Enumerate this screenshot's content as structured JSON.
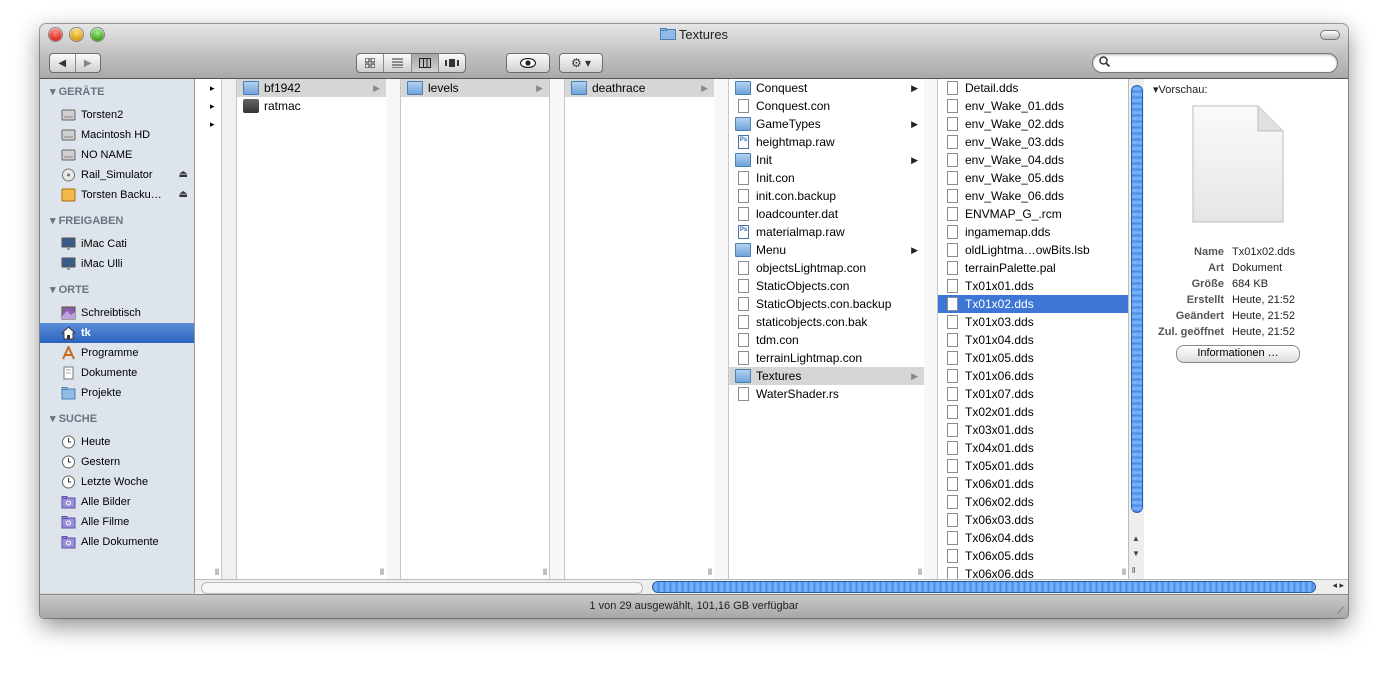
{
  "window": {
    "title": "Textures"
  },
  "toolbar": {
    "nav": [
      "◀",
      "▶"
    ],
    "views": [
      "icon-view",
      "list-view",
      "column-view",
      "coverflow-view"
    ],
    "quicklook": "👁",
    "action": "⚙ ▾",
    "search": {
      "value": "",
      "placeholder": ""
    }
  },
  "sidebar": {
    "sections": [
      {
        "title": "GERÄTE",
        "items": [
          {
            "label": "Torsten2",
            "icon": "hd-icon"
          },
          {
            "label": "Macintosh HD",
            "icon": "hd-icon"
          },
          {
            "label": "NO NAME",
            "icon": "hd-icon"
          },
          {
            "label": "Rail_Simulator",
            "icon": "cd-icon",
            "eject": true
          },
          {
            "label": "Torsten Backu…",
            "icon": "backup-icon",
            "eject": true
          }
        ]
      },
      {
        "title": "FREIGABEN",
        "items": [
          {
            "label": "iMac Cati",
            "icon": "imac-icon"
          },
          {
            "label": "iMac Ulli",
            "icon": "imac-icon"
          }
        ]
      },
      {
        "title": "ORTE",
        "items": [
          {
            "label": "Schreibtisch",
            "icon": "desktop-icon"
          },
          {
            "label": "tk",
            "icon": "home-icon",
            "selected": true
          },
          {
            "label": "Programme",
            "icon": "apps-icon"
          },
          {
            "label": "Dokumente",
            "icon": "documents-icon"
          },
          {
            "label": "Projekte",
            "icon": "folder-icon"
          }
        ]
      },
      {
        "title": "SUCHE",
        "items": [
          {
            "label": "Heute",
            "icon": "clock-icon"
          },
          {
            "label": "Gestern",
            "icon": "clock-icon"
          },
          {
            "label": "Letzte Woche",
            "icon": "clock-icon"
          },
          {
            "label": "Alle Bilder",
            "icon": "smart-folder-icon"
          },
          {
            "label": "Alle Filme",
            "icon": "smart-folder-icon"
          },
          {
            "label": "Alle Dokumente",
            "icon": "smart-folder-icon"
          }
        ]
      }
    ]
  },
  "columns": [
    {
      "items": [
        {
          "label": "bf1942",
          "type": "folder",
          "path": true,
          "arrow": true
        },
        {
          "label": "ratmac",
          "type": "disk"
        }
      ]
    },
    {
      "items": [
        {
          "label": "levels",
          "type": "folder",
          "path": true,
          "arrow": true
        }
      ]
    },
    {
      "items": [
        {
          "label": "deathrace",
          "type": "folder",
          "path": true,
          "arrow": true
        }
      ]
    },
    {
      "items": [
        {
          "label": "Conquest",
          "type": "folder",
          "arrow": true
        },
        {
          "label": "Conquest.con",
          "type": "doc"
        },
        {
          "label": "GameTypes",
          "type": "folder",
          "arrow": true
        },
        {
          "label": "heightmap.raw",
          "type": "ps"
        },
        {
          "label": "Init",
          "type": "folder",
          "arrow": true
        },
        {
          "label": "Init.con",
          "type": "doc"
        },
        {
          "label": "init.con.backup",
          "type": "doc"
        },
        {
          "label": "loadcounter.dat",
          "type": "doc"
        },
        {
          "label": "materialmap.raw",
          "type": "ps"
        },
        {
          "label": "Menu",
          "type": "folder",
          "arrow": true
        },
        {
          "label": "objectsLightmap.con",
          "type": "doc"
        },
        {
          "label": "StaticObjects.con",
          "type": "doc"
        },
        {
          "label": "StaticObjects.con.backup",
          "type": "doc"
        },
        {
          "label": "staticobjects.con.bak",
          "type": "doc"
        },
        {
          "label": "tdm.con",
          "type": "doc"
        },
        {
          "label": "terrainLightmap.con",
          "type": "doc"
        },
        {
          "label": "Textures",
          "type": "folder",
          "path": true,
          "arrow": true
        },
        {
          "label": "WaterShader.rs",
          "type": "doc"
        }
      ]
    },
    {
      "items": [
        {
          "label": "Detail.dds",
          "type": "doc"
        },
        {
          "label": "env_Wake_01.dds",
          "type": "doc"
        },
        {
          "label": "env_Wake_02.dds",
          "type": "doc"
        },
        {
          "label": "env_Wake_03.dds",
          "type": "doc"
        },
        {
          "label": "env_Wake_04.dds",
          "type": "doc"
        },
        {
          "label": "env_Wake_05.dds",
          "type": "doc"
        },
        {
          "label": "env_Wake_06.dds",
          "type": "doc"
        },
        {
          "label": "ENVMAP_G_.rcm",
          "type": "doc"
        },
        {
          "label": "ingamemap.dds",
          "type": "doc"
        },
        {
          "label": "oldLightma…owBits.lsb",
          "type": "doc"
        },
        {
          "label": "terrainPalette.pal",
          "type": "doc"
        },
        {
          "label": "Tx01x01.dds",
          "type": "doc"
        },
        {
          "label": "Tx01x02.dds",
          "type": "doc",
          "selected": true
        },
        {
          "label": "Tx01x03.dds",
          "type": "doc"
        },
        {
          "label": "Tx01x04.dds",
          "type": "doc"
        },
        {
          "label": "Tx01x05.dds",
          "type": "doc"
        },
        {
          "label": "Tx01x06.dds",
          "type": "doc"
        },
        {
          "label": "Tx01x07.dds",
          "type": "doc"
        },
        {
          "label": "Tx02x01.dds",
          "type": "doc"
        },
        {
          "label": "Tx03x01.dds",
          "type": "doc"
        },
        {
          "label": "Tx04x01.dds",
          "type": "doc"
        },
        {
          "label": "Tx05x01.dds",
          "type": "doc"
        },
        {
          "label": "Tx06x01.dds",
          "type": "doc"
        },
        {
          "label": "Tx06x02.dds",
          "type": "doc"
        },
        {
          "label": "Tx06x03.dds",
          "type": "doc"
        },
        {
          "label": "Tx06x04.dds",
          "type": "doc"
        },
        {
          "label": "Tx06x05.dds",
          "type": "doc"
        },
        {
          "label": "Tx06x06.dds",
          "type": "doc"
        }
      ]
    }
  ],
  "preview": {
    "heading": "Vorschau:",
    "info": [
      {
        "key": "Name",
        "value": "Tx01x02.dds"
      },
      {
        "key": "Art",
        "value": "Dokument"
      },
      {
        "key": "Größe",
        "value": "684 KB"
      },
      {
        "key": "Erstellt",
        "value": "Heute, 21:52"
      },
      {
        "key": "Geändert",
        "value": "Heute, 21:52"
      },
      {
        "key": "Zul. geöffnet",
        "value": "Heute, 21:52"
      }
    ],
    "button": "Informationen …"
  },
  "status": {
    "text": "1 von 29 ausgewählt, 101,16 GB verfügbar"
  },
  "colors": {
    "selection": "#3e76d6",
    "sidebar_bg": "#dde4ec",
    "sidebar_sel": "#2a63c0"
  }
}
